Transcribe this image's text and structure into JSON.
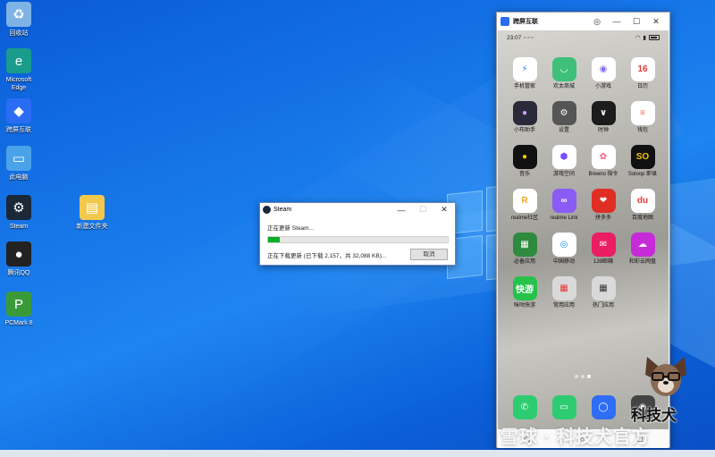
{
  "desktop": {
    "icons": [
      {
        "label": "回收站",
        "icon": "recycle-bin-icon",
        "color": "#7fb3e6"
      },
      {
        "label": "Microsoft Edge",
        "icon": "edge-icon",
        "color": "#1a9c8c"
      },
      {
        "label": "跨屏互联",
        "icon": "cross-screen-icon",
        "color": "#2a6df4"
      },
      {
        "label": "此电脑",
        "icon": "computer-icon",
        "color": "#4aa3e8"
      },
      {
        "label": "Steam",
        "icon": "steam-icon",
        "color": "#1b2838"
      },
      {
        "label": "腾讯QQ",
        "icon": "qq-icon",
        "color": "#222222"
      },
      {
        "label": "PCMark 8",
        "icon": "pcmark-icon",
        "color": "#3a9a3a"
      },
      {
        "label": "新建文件夹",
        "icon": "folder-icon",
        "color": "#f3c84b"
      }
    ]
  },
  "steam_dialog": {
    "title": "Steam",
    "minimize": "—",
    "maximize": "☐",
    "close": "✕",
    "message": "正在更新 Steam...",
    "progress": 0.066,
    "status": "正在下载更新 (已下载 2,157，共 32,088 KB)...",
    "cancel_label": "取消"
  },
  "phone_window": {
    "title": "跨屏互联",
    "settings": "◎",
    "minimize": "—",
    "maximize": "☐",
    "close": "✕",
    "status_time": "23:07",
    "apps": [
      {
        "label": "手机管家",
        "icon": "phone-manager-icon",
        "bg": "#ffffff",
        "fg": "#2a7df4",
        "glyph": "⚡"
      },
      {
        "label": "欢太商城",
        "icon": "store-icon",
        "bg": "#3fc07a",
        "fg": "#ffffff",
        "glyph": "◡"
      },
      {
        "label": "小游戏",
        "icon": "mini-games-icon",
        "bg": "#ffffff",
        "fg": "#7b6cf0",
        "glyph": "◉"
      },
      {
        "label": "日历",
        "icon": "calendar-icon",
        "bg": "#ffffff",
        "fg": "#e53935",
        "glyph": "16"
      },
      {
        "label": "小布助手",
        "icon": "assistant-icon",
        "bg": "#2a2a3a",
        "fg": "#c9a0ff",
        "glyph": "●"
      },
      {
        "label": "设置",
        "icon": "settings-icon",
        "bg": "#555555",
        "fg": "#ffffff",
        "glyph": "⚙"
      },
      {
        "label": "时钟",
        "icon": "clock-icon",
        "bg": "#1c1c1c",
        "fg": "#ffffff",
        "glyph": "∨"
      },
      {
        "label": "钱包",
        "icon": "wallet-icon",
        "bg": "#ffffff",
        "fg": "#ff6a4d",
        "glyph": "≡"
      },
      {
        "label": "音乐",
        "icon": "music-icon",
        "bg": "#111111",
        "fg": "#f5c400",
        "glyph": "●"
      },
      {
        "label": "游戏空间",
        "icon": "game-space-icon",
        "bg": "#ffffff",
        "fg": "#7a4cff",
        "glyph": "⬢"
      },
      {
        "label": "Breeno 指令",
        "icon": "breeno-icon",
        "bg": "#ffffff",
        "fg": "#ff5a7a",
        "glyph": "✿"
      },
      {
        "label": "Soloop 即录",
        "icon": "soloop-icon",
        "bg": "#111111",
        "fg": "#f5c400",
        "glyph": "SO"
      },
      {
        "label": "realme社区",
        "icon": "realme-community-icon",
        "bg": "#ffffff",
        "fg": "#f5a623",
        "glyph": "R"
      },
      {
        "label": "realme Link",
        "icon": "realme-link-icon",
        "bg": "#8a5cf5",
        "fg": "#ffffff",
        "glyph": "∞"
      },
      {
        "label": "拼多多",
        "icon": "pinduoduo-icon",
        "bg": "#e02e24",
        "fg": "#ffffff",
        "glyph": "❤"
      },
      {
        "label": "百度地图",
        "icon": "baidu-map-icon",
        "bg": "#ffffff",
        "fg": "#e53935",
        "glyph": "du"
      },
      {
        "label": "必备应用",
        "icon": "essential-apps-icon",
        "bg": "#2d8a3e",
        "fg": "#ffffff",
        "glyph": "▦"
      },
      {
        "label": "中国移动",
        "icon": "china-mobile-icon",
        "bg": "#ffffff",
        "fg": "#1e88e5",
        "glyph": "◎"
      },
      {
        "label": "139邮箱",
        "icon": "139-mail-icon",
        "bg": "#e91e63",
        "fg": "#ffffff",
        "glyph": "✉"
      },
      {
        "label": "和彩云网盘",
        "icon": "cloud-drive-icon",
        "bg": "#c62bd8",
        "fg": "#ffffff",
        "glyph": "☁"
      },
      {
        "label": "咪咕快游",
        "icon": "migu-games-icon",
        "bg": "#26c24a",
        "fg": "#ffffff",
        "glyph": "快游"
      },
      {
        "label": "常用应用",
        "icon": "common-apps-icon",
        "bg": "#d9d9d9",
        "fg": "#e53935",
        "glyph": "▦"
      },
      {
        "label": "热门应用",
        "icon": "hot-apps-icon",
        "bg": "#d9d9d9",
        "fg": "#333333",
        "glyph": "▦"
      }
    ],
    "dock": [
      {
        "icon": "phone-icon",
        "bg": "#2ecc71",
        "fg": "#ffffff",
        "glyph": "✆"
      },
      {
        "icon": "messages-icon",
        "bg": "#2ecc71",
        "fg": "#ffffff",
        "glyph": "▭"
      },
      {
        "icon": "browser-icon",
        "bg": "#2f6df6",
        "fg": "#ffffff",
        "glyph": "◯"
      },
      {
        "icon": "camera-icon",
        "bg": "#444444",
        "fg": "#ffffff",
        "glyph": "◉"
      }
    ],
    "nav": {
      "back": "◁",
      "home": "○",
      "recents": "▢"
    }
  },
  "watermark": {
    "text": "雪球 · 科技犬官方",
    "mascot_text": "科技犬"
  }
}
